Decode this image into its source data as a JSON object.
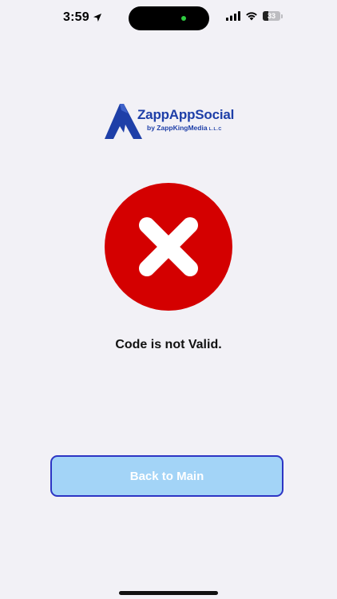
{
  "status_bar": {
    "time": "3:59",
    "battery_level": "33",
    "battery_fraction": 0.33,
    "icons": [
      "location-arrow-icon",
      "cellular-signal-icon",
      "wifi-icon",
      "battery-icon"
    ]
  },
  "logo": {
    "title": "ZappAppSocial",
    "subtitle": "by ZappKingMedia",
    "suffix": "L.L.C",
    "brand_color": "#1e3fa8"
  },
  "result": {
    "icon": "error-x-icon",
    "icon_color": "#d40000",
    "message": "Code is not Valid."
  },
  "actions": {
    "back_label": "Back to Main",
    "button_fill": "#a3d4f7",
    "button_border": "#2d35c4"
  },
  "colors": {
    "background": "#f2f1f6"
  }
}
